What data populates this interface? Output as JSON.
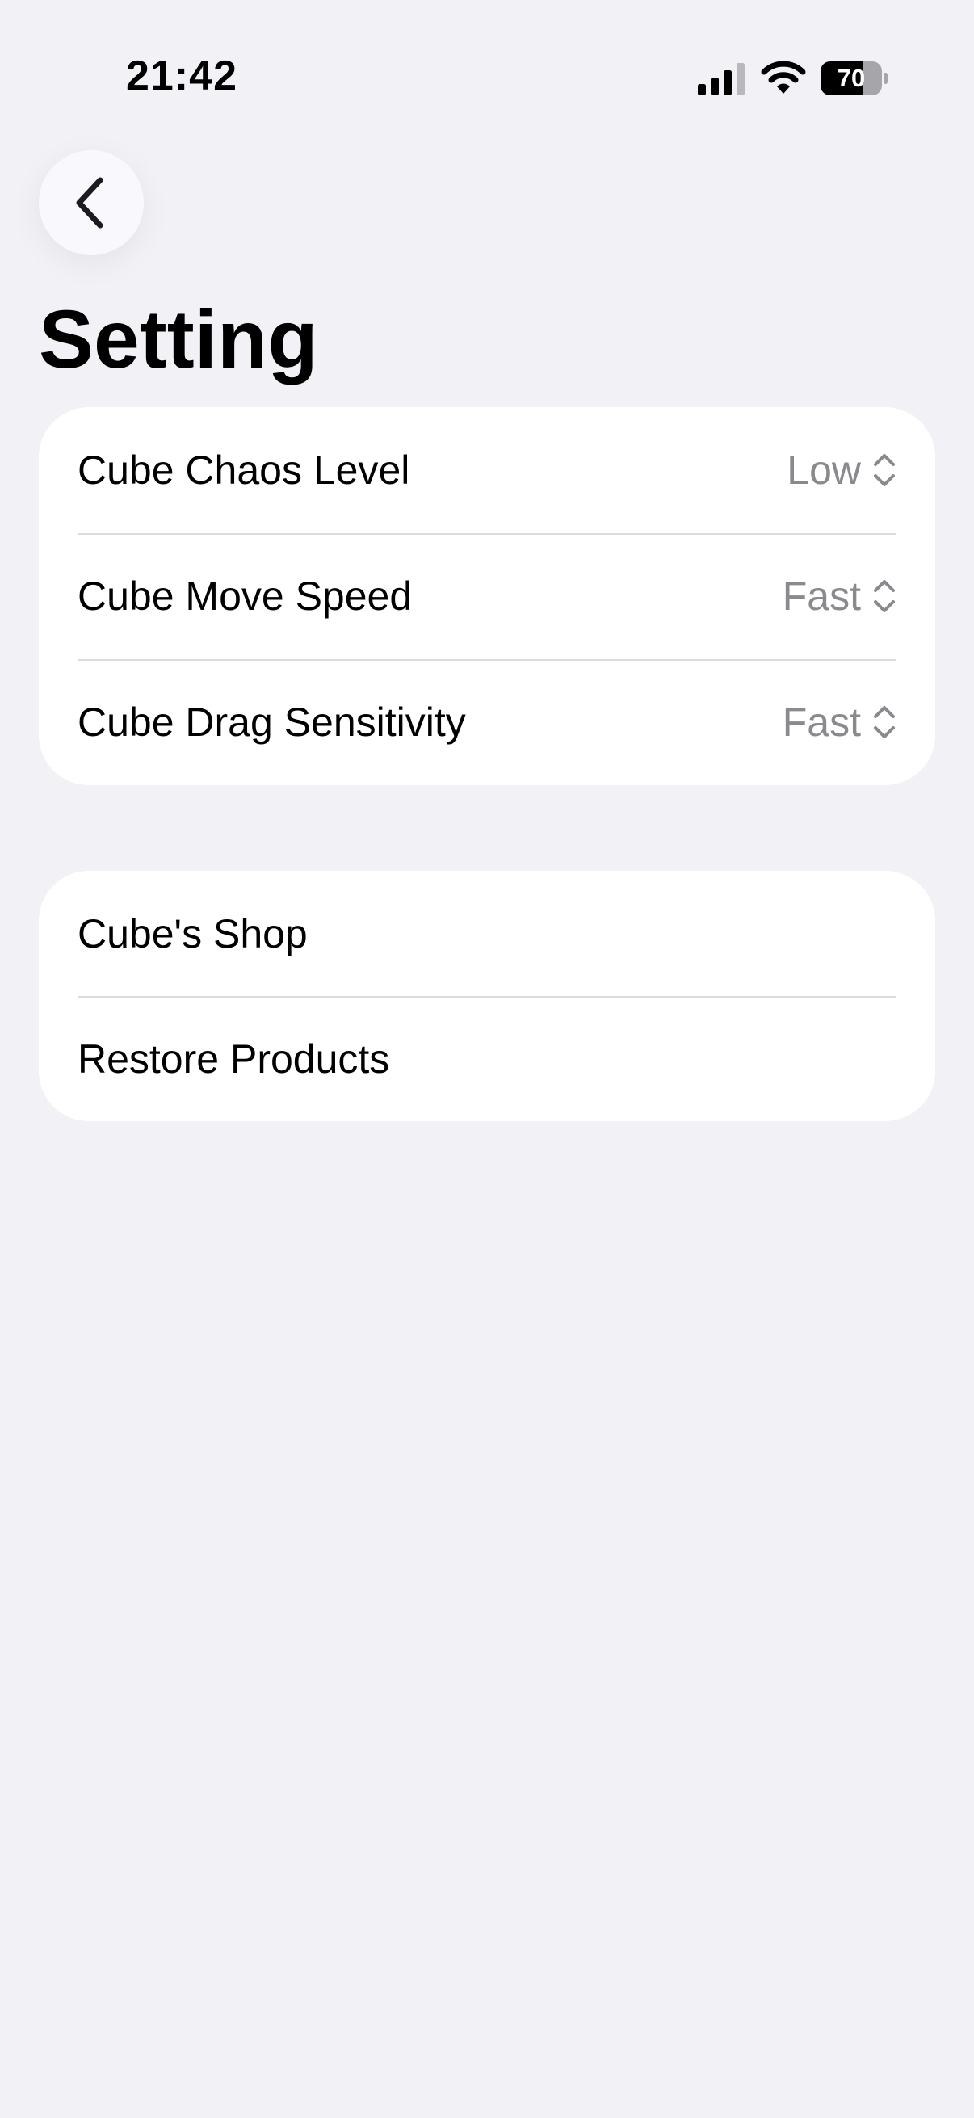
{
  "status_bar": {
    "time": "21:42",
    "battery_level": "70",
    "icons": [
      "signal-icon",
      "wifi-icon",
      "battery-icon"
    ]
  },
  "nav": {
    "back_icon": "chevron-left-icon"
  },
  "page": {
    "title": "Setting"
  },
  "settings_group": {
    "rows": [
      {
        "label": "Cube Chaos Level",
        "value": "Low"
      },
      {
        "label": "Cube Move Speed",
        "value": "Fast"
      },
      {
        "label": "Cube Drag Sensitivity",
        "value": "Fast"
      }
    ],
    "picker_icon": "chevron-up-down-icon"
  },
  "store_group": {
    "rows": [
      {
        "label": "Cube's Shop"
      },
      {
        "label": "Restore Products"
      }
    ]
  },
  "colors": {
    "background": "#f2f1f6",
    "card": "#ffffff",
    "value_text": "#8a8a8e",
    "separator": "#dcdce0"
  }
}
